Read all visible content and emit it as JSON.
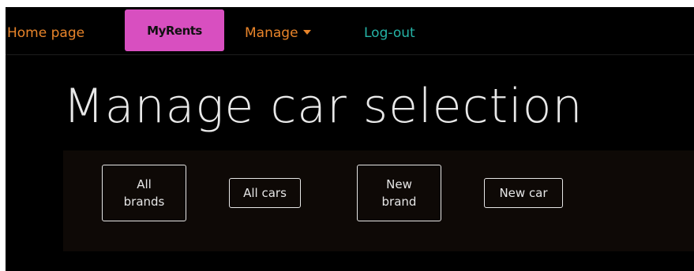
{
  "navbar": {
    "home": "Home page",
    "myrents": "MyRents",
    "manage": "Manage",
    "logout": "Log-out"
  },
  "main": {
    "title": "Manage car selection",
    "buttons": {
      "all_brands": "All\nbrands",
      "all_cars": "All cars",
      "new_brand": "New\nbrand",
      "new_car": "New car"
    }
  },
  "colors": {
    "background": "#000000",
    "nav_orange": "#e8842a",
    "nav_teal": "#25b3a6",
    "active_pink": "#d84fc0",
    "panel": "#0e0906",
    "text_light": "#e8e8e8"
  },
  "icons": {
    "manage_dropdown": "caret-down-icon"
  }
}
